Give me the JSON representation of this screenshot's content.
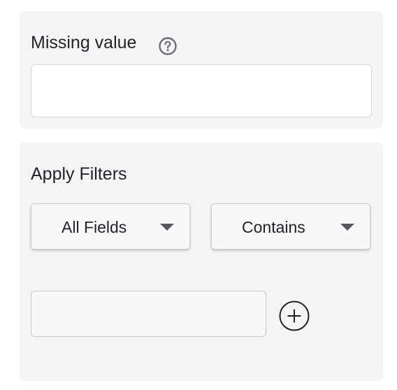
{
  "missing_value": {
    "label": "Missing value",
    "help_icon": "question-circle-icon",
    "input_value": "",
    "input_placeholder": ""
  },
  "filters": {
    "title": "Apply Filters",
    "field_dropdown": {
      "selected": "All Fields",
      "icon": "chevron-down-icon"
    },
    "operator_dropdown": {
      "selected": "Contains",
      "icon": "chevron-down-icon"
    },
    "value_input": {
      "value": "",
      "placeholder": ""
    },
    "add_button_icon": "plus-circle-icon"
  },
  "colors": {
    "panel_bg": "#f3f4f6",
    "text": "#1f2328",
    "border": "#d6d8dc",
    "icon": "#55595f"
  }
}
